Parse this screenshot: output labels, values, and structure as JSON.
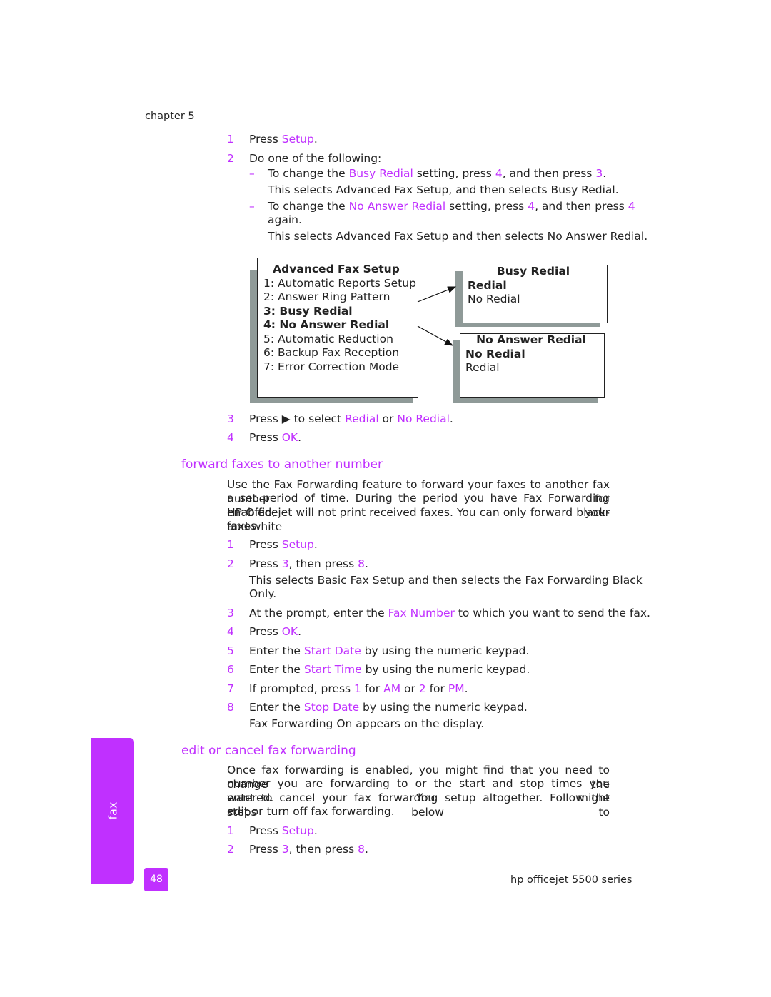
{
  "header": {
    "chapter": "chapter 5"
  },
  "accent": "#c030ff",
  "lines": [
    {
      "marker": "1",
      "segs": [
        {
          "t": "Press "
        },
        {
          "t": "Setup",
          "hl": true
        },
        {
          "t": "."
        }
      ]
    },
    {
      "marker": "2",
      "segs": [
        {
          "t": "Do one of the following:"
        }
      ]
    },
    {
      "marker": "–",
      "segs": [
        {
          "t": "To change the "
        },
        {
          "t": "Busy Redial",
          "hl": true
        },
        {
          "t": " setting, press "
        },
        {
          "t": "4",
          "hl": true
        },
        {
          "t": ", and then press "
        },
        {
          "t": "3",
          "hl": true
        },
        {
          "t": "."
        }
      ]
    },
    {
      "segs": [
        {
          "t": "This selects Advanced Fax Setup, and then selects Busy Redial."
        }
      ]
    },
    {
      "marker": "–",
      "segs": [
        {
          "t": "To change the "
        },
        {
          "t": "No Answer Redial",
          "hl": true
        },
        {
          "t": " setting, press "
        },
        {
          "t": "4",
          "hl": true
        },
        {
          "t": ", and then press "
        },
        {
          "t": "4",
          "hl": true
        }
      ]
    },
    {
      "segs": [
        {
          "t": "again."
        }
      ]
    },
    {
      "segs": [
        {
          "t": "This selects Advanced Fax Setup and then selects No Answer Redial."
        }
      ]
    },
    {
      "marker": "3",
      "segs": [
        {
          "t": "Press "
        },
        {
          "t": "▶"
        },
        {
          "t": " to select "
        },
        {
          "t": "Redial",
          "hl": true
        },
        {
          "t": " or "
        },
        {
          "t": "No Redial",
          "hl": true
        },
        {
          "t": "."
        }
      ]
    },
    {
      "marker": "4",
      "segs": [
        {
          "t": "Press "
        },
        {
          "t": "OK",
          "hl": true
        },
        {
          "t": "."
        }
      ]
    },
    {
      "heading": "forward faxes to another number"
    },
    {
      "segs": [
        {
          "t": "Use the Fax Forwarding feature to forward your faxes to another fax number for"
        }
      ]
    },
    {
      "segs": [
        {
          "t": "a set period of time. During the period you have Fax Forwarding enabled, your"
        }
      ]
    },
    {
      "segs": [
        {
          "t": "HP Officejet will not print received faxes. You can only forward black-and-white"
        }
      ]
    },
    {
      "segs": [
        {
          "t": "faxes."
        }
      ]
    },
    {
      "marker": "1",
      "segs": [
        {
          "t": "Press "
        },
        {
          "t": "Setup",
          "hl": true
        },
        {
          "t": "."
        }
      ]
    },
    {
      "marker": "2",
      "segs": [
        {
          "t": "Press "
        },
        {
          "t": "3",
          "hl": true
        },
        {
          "t": ", then press "
        },
        {
          "t": "8",
          "hl": true
        },
        {
          "t": "."
        }
      ]
    },
    {
      "segs": [
        {
          "t": "This selects Basic Fax Setup and then selects the Fax Forwarding Black"
        }
      ]
    },
    {
      "segs": [
        {
          "t": "Only."
        }
      ]
    },
    {
      "marker": "3",
      "segs": [
        {
          "t": "At the prompt, enter the "
        },
        {
          "t": "Fax Number",
          "hl": true
        },
        {
          "t": " to which you want to send the fax."
        }
      ]
    },
    {
      "marker": "4",
      "segs": [
        {
          "t": "Press "
        },
        {
          "t": "OK",
          "hl": true
        },
        {
          "t": "."
        }
      ]
    },
    {
      "marker": "5",
      "segs": [
        {
          "t": "Enter the "
        },
        {
          "t": "Start Date",
          "hl": true
        },
        {
          "t": " by using the numeric keypad."
        }
      ]
    },
    {
      "marker": "6",
      "segs": [
        {
          "t": "Enter the "
        },
        {
          "t": "Start Time",
          "hl": true
        },
        {
          "t": " by using the numeric keypad."
        }
      ]
    },
    {
      "marker": "7",
      "segs": [
        {
          "t": "If prompted, press "
        },
        {
          "t": "1",
          "hl": true
        },
        {
          "t": " for "
        },
        {
          "t": "AM",
          "hl": true
        },
        {
          "t": " or "
        },
        {
          "t": "2",
          "hl": true
        },
        {
          "t": " for "
        },
        {
          "t": "PM",
          "hl": true
        },
        {
          "t": "."
        }
      ]
    },
    {
      "marker": "8",
      "segs": [
        {
          "t": "Enter the "
        },
        {
          "t": "Stop Date",
          "hl": true
        },
        {
          "t": " by using the numeric keypad."
        }
      ]
    },
    {
      "segs": [
        {
          "t": "Fax Forwarding On appears on the display."
        }
      ]
    },
    {
      "heading": "edit or cancel fax forwarding"
    },
    {
      "segs": [
        {
          "t": "Once fax forwarding is enabled, you might find that you need to change the"
        }
      ]
    },
    {
      "segs": [
        {
          "t": "number you are forwarding to or the start and stop times you entered. You might"
        }
      ]
    },
    {
      "segs": [
        {
          "t": "want to cancel your fax forwarding setup altogether. Follow the steps below to"
        }
      ]
    },
    {
      "segs": [
        {
          "t": "edit or turn off fax forwarding."
        }
      ]
    },
    {
      "marker": "1",
      "segs": [
        {
          "t": "Press "
        },
        {
          "t": "Setup",
          "hl": true
        },
        {
          "t": "."
        }
      ]
    },
    {
      "marker": "2",
      "segs": [
        {
          "t": "Press "
        },
        {
          "t": "3",
          "hl": true
        },
        {
          "t": ", then press "
        },
        {
          "t": "8",
          "hl": true
        },
        {
          "t": "."
        }
      ]
    }
  ],
  "diagram": {
    "menu": {
      "title": "Advanced Fax Setup",
      "items": [
        {
          "t": "1: Automatic Reports Setup"
        },
        {
          "t": "2: Answer Ring Pattern"
        },
        {
          "t": "3: Busy Redial",
          "bold": true
        },
        {
          "t": "4: No Answer Redial",
          "bold": true
        },
        {
          "t": "5: Automatic Reduction"
        },
        {
          "t": "6: Backup Fax Reception"
        },
        {
          "t": "7: Error Correction Mode"
        }
      ]
    },
    "busy": {
      "title": "Busy Redial",
      "items": [
        {
          "t": "Redial",
          "bold": true
        },
        {
          "t": "No Redial"
        }
      ]
    },
    "noanswer": {
      "title": "No Answer Redial",
      "items": [
        {
          "t": "No Redial",
          "bold": true
        },
        {
          "t": "Redial"
        }
      ]
    }
  },
  "sidebar_tab": "fax",
  "footer": {
    "page_number": "48",
    "product": "hp officejet 5500 series"
  }
}
